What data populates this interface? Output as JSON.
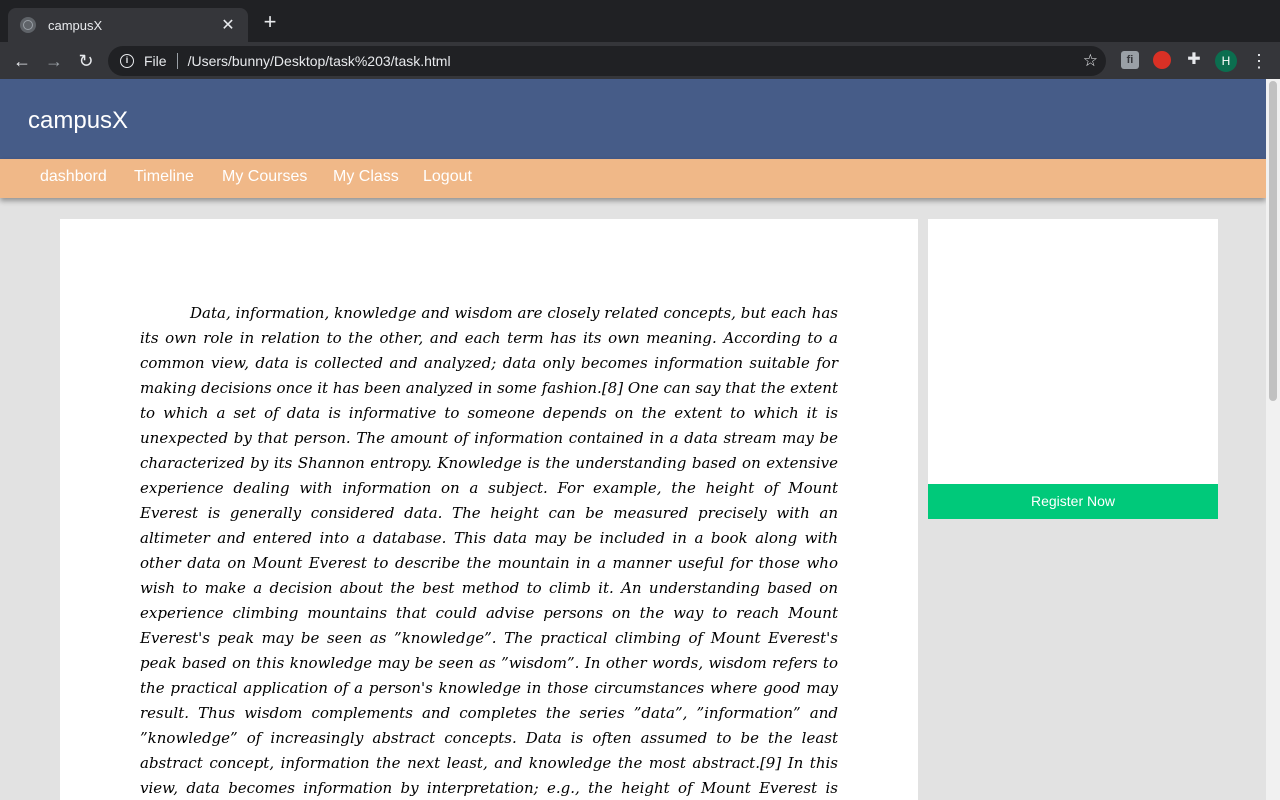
{
  "browser": {
    "tab_title": "campusX",
    "tab_close": "✕",
    "new_tab": "+",
    "back": "←",
    "forward": "→",
    "reload": "↻",
    "info": "i",
    "scheme": "File",
    "url": "/Users/bunny/Desktop/task%203/task.html",
    "star": "☆",
    "extension_letter": "fi",
    "puzzle": "✚",
    "profile_initial": "H",
    "menu": "⋮"
  },
  "site": {
    "brand": "campusX",
    "nav": [
      "dashbord",
      "Timeline",
      "My Courses",
      "My Class",
      "Logout"
    ],
    "article": "Data, information, knowledge and wisdom are closely related concepts, but each has its own role in relation to the other, and each term has its own meaning. According to a common view, data is collected and analyzed; data only becomes information suitable for making decisions once it has been analyzed in some fashion.[8] One can say that the extent to which a set of data is informative to someone depends on the extent to which it is unexpected by that person. The amount of information contained in a data stream may be characterized by its Shannon entropy. Knowledge is the understanding based on extensive experience dealing with information on a subject. For example, the height of Mount Everest is generally considered data. The height can be measured precisely with an altimeter and entered into a database. This data may be included in a book along with other data on Mount Everest to describe the mountain in a manner useful for those who wish to make a decision about the best method to climb it. An understanding based on experience climbing mountains that could advise persons on the way to reach Mount Everest's peak may be seen as ”knowledge”. The practical climbing of Mount Everest's peak based on this knowledge may be seen as ”wisdom”. In other words, wisdom refers to the practical application of a person's knowledge in those circumstances where good may result. Thus wisdom complements and completes the series ”data”, ”information” and ”knowledge” of increasingly abstract concepts. Data is often assumed to be the least abstract concept, information the next least, and knowledge the most abstract.[9] In this view, data becomes information by interpretation; e.g., the height of Mount Everest is generally considered ”data”, a book on Mount Everest",
    "register_label": "Register Now"
  },
  "colors": {
    "header": "#465c88",
    "nav": "#f0b888",
    "register": "#00c97a"
  }
}
